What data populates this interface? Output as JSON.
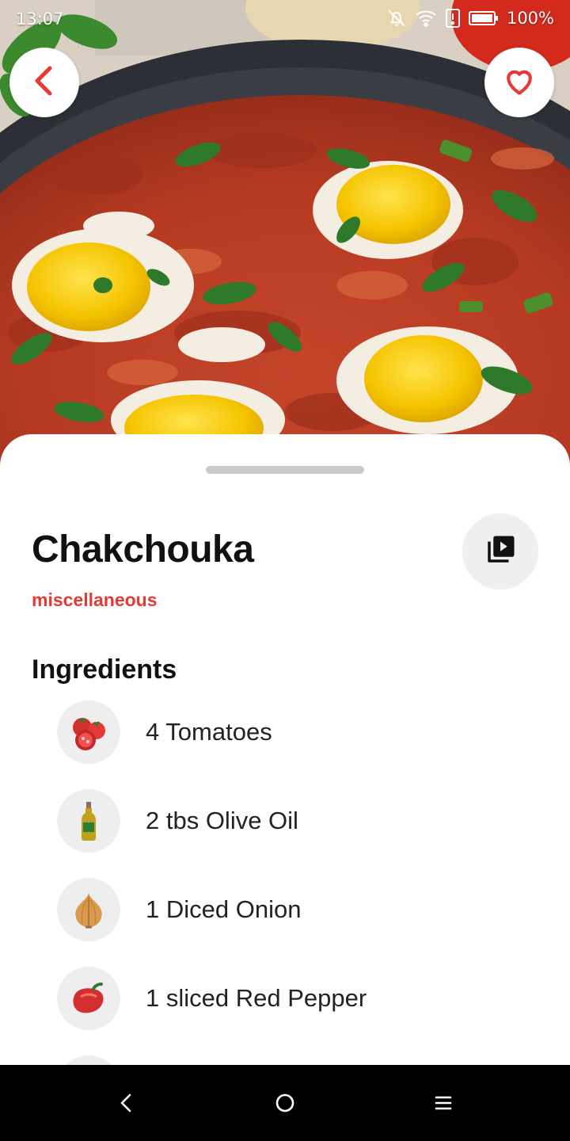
{
  "status_bar": {
    "time": "13:07",
    "battery_percent": "100%",
    "icons": [
      "alarm-off-icon",
      "wifi-icon",
      "alert-icon",
      "battery-icon"
    ]
  },
  "header": {
    "back_icon": "chevron-left-icon",
    "favorite_icon": "heart-outline-icon"
  },
  "recipe": {
    "title": "Chakchouka",
    "category": "miscellaneous",
    "video_icon": "video-library-icon"
  },
  "ingredients": {
    "heading": "Ingredients",
    "items": [
      {
        "label": "4 Tomatoes",
        "icon": "tomato-icon"
      },
      {
        "label": "2 tbs Olive Oil",
        "icon": "olive-oil-icon"
      },
      {
        "label": "1 Diced Onion",
        "icon": "onion-icon"
      },
      {
        "label": "1 sliced Red Pepper",
        "icon": "red-pepper-icon"
      }
    ]
  },
  "nav_bar": {
    "icons": [
      "nav-back-icon",
      "nav-home-icon",
      "nav-menu-icon"
    ]
  },
  "colors": {
    "accent": "#e53935",
    "text_primary": "#111111",
    "chip_background": "#eeeeee"
  }
}
